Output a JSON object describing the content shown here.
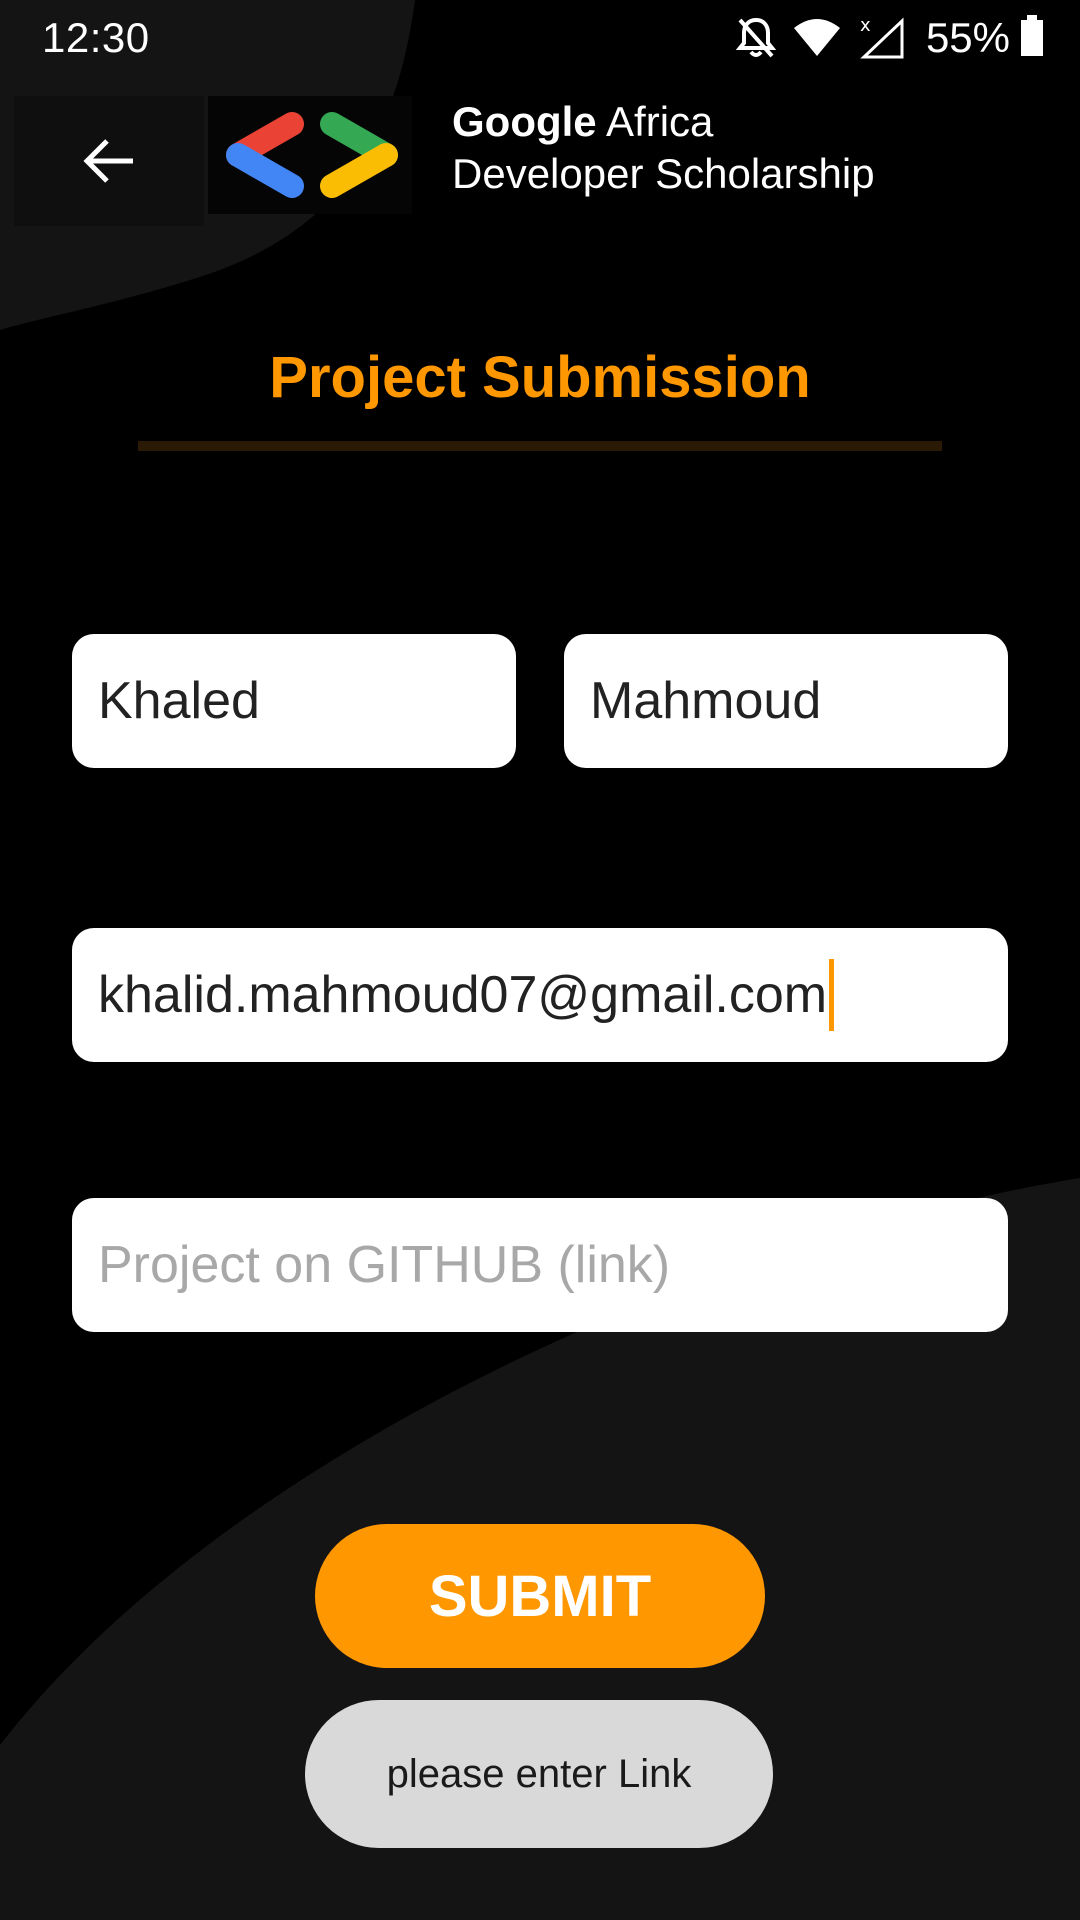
{
  "status_bar": {
    "time": "12:30",
    "battery_percent": "55%",
    "icons": [
      "notifications-off-icon",
      "wifi-icon",
      "no-signal-icon",
      "battery-icon"
    ]
  },
  "header": {
    "back_icon": "arrow-back-icon",
    "logo_icon": "gads-logo-icon",
    "brand_line1_bold": "Google",
    "brand_line1_rest": " Africa",
    "brand_line2": "Developer Scholarship"
  },
  "page": {
    "title": "Project Submission"
  },
  "form": {
    "first_name": {
      "value": "Khaled",
      "placeholder": ""
    },
    "last_name": {
      "value": "Mahmoud",
      "placeholder": ""
    },
    "email": {
      "value": "khalid.mahmoud07@gmail.com",
      "placeholder": ""
    },
    "github_link": {
      "value": "",
      "placeholder": "Project on GITHUB (link)"
    },
    "submit_label": "SUBMIT"
  },
  "toast": {
    "message": "please enter Link"
  },
  "colors": {
    "accent": "#ff9800",
    "background": "#000000",
    "background_shape": "#141414",
    "toast_bg": "#d9d9d9"
  }
}
